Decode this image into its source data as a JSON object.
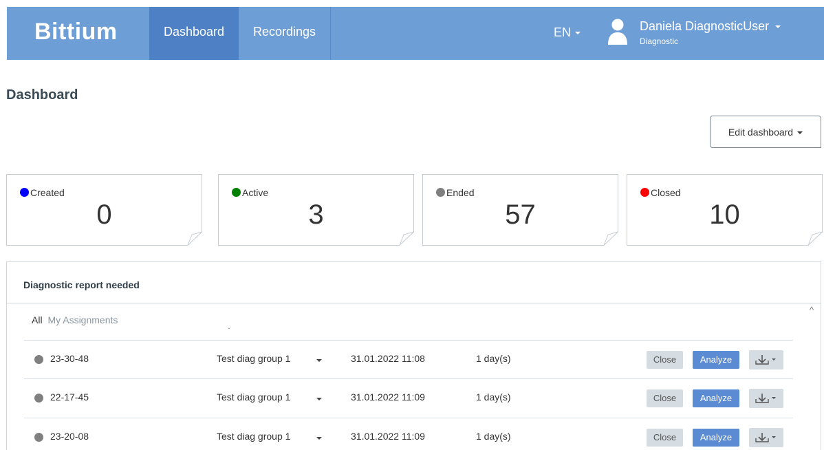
{
  "navbar": {
    "brand": "Bittium",
    "items": [
      {
        "label": "Dashboard",
        "active": true
      },
      {
        "label": "Recordings",
        "active": false
      }
    ],
    "language": "EN",
    "user": {
      "name": "Daniela DiagnosticUser",
      "role": "Diagnostic"
    }
  },
  "page": {
    "title": "Dashboard",
    "edit_button": "Edit dashboard"
  },
  "cards": [
    {
      "label": "Created",
      "value": "0",
      "color": "#0000ff"
    },
    {
      "label": "Active",
      "value": "3",
      "color": "#008000"
    },
    {
      "label": "Ended",
      "value": "57",
      "color": "#808080"
    },
    {
      "label": "Closed",
      "value": "10",
      "color": "#ff0000"
    }
  ],
  "panel": {
    "title": "Diagnostic report needed",
    "filters": {
      "all": "All",
      "mine": "My Assignments"
    },
    "rows": [
      {
        "id": "23-30-48",
        "group": "Test diag group 1",
        "date": "31.01.2022 11:08",
        "duration": "1 day(s)",
        "close": "Close",
        "analyze": "Analyze"
      },
      {
        "id": "22-17-45",
        "group": "Test diag group 1",
        "date": "31.01.2022 11:09",
        "duration": "1 day(s)",
        "close": "Close",
        "analyze": "Analyze"
      },
      {
        "id": "23-20-08",
        "group": "Test diag group 1",
        "date": "31.01.2022 11:09",
        "duration": "1 day(s)",
        "close": "Close",
        "analyze": "Analyze"
      }
    ]
  }
}
